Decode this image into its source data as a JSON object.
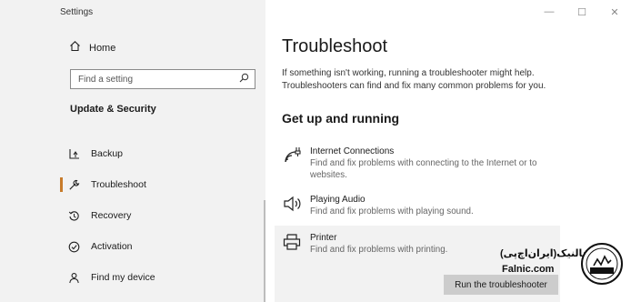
{
  "window": {
    "title": "Settings",
    "controls": {
      "minimize": "—",
      "maximize": "☐",
      "close": "✕"
    }
  },
  "sidebar": {
    "home_label": "Home",
    "search_placeholder": "Find a setting",
    "section_title": "Update & Security",
    "items": [
      {
        "label": "Backup",
        "icon": "backup-icon"
      },
      {
        "label": "Troubleshoot",
        "icon": "wrench-icon",
        "selected": true
      },
      {
        "label": "Recovery",
        "icon": "recovery-icon"
      },
      {
        "label": "Activation",
        "icon": "check-circle-icon"
      },
      {
        "label": "Find my device",
        "icon": "person-location-icon"
      }
    ]
  },
  "main": {
    "title": "Troubleshoot",
    "intro": "If something isn't working, running a troubleshooter might help. Troubleshooters can find and fix many common problems for you.",
    "subheading": "Get up and running",
    "troubleshooters": [
      {
        "name": "Internet Connections",
        "desc": "Find and fix problems with connecting to the Internet or to websites.",
        "icon": "wifi-icon"
      },
      {
        "name": "Playing Audio",
        "desc": "Find and fix problems with playing sound.",
        "icon": "speaker-icon"
      },
      {
        "name": "Printer",
        "desc": "Find and fix problems with printing.",
        "icon": "printer-icon",
        "expanded": true
      }
    ],
    "run_button": "Run the troubleshooter"
  },
  "watermark": {
    "persian": "فالنیک(ایران‌اچ‌پی)",
    "latin": "Falnic.com",
    "seal": "iranhp"
  },
  "colors": {
    "sidebar_bg": "#f2f2f2",
    "accent": "#c77b2a",
    "button_bg": "#cccccc"
  }
}
